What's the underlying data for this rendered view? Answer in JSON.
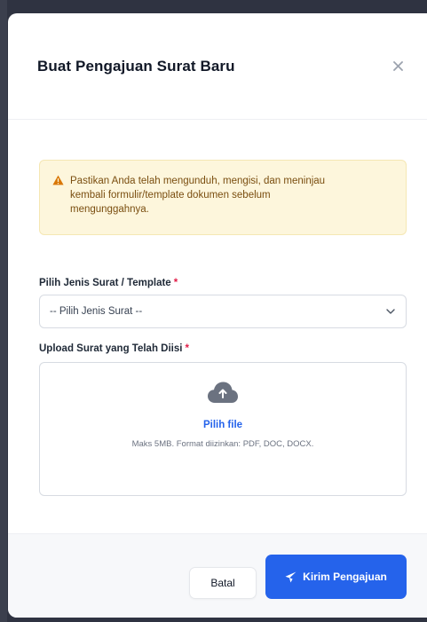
{
  "modal": {
    "title": "Buat Pengajuan Surat Baru",
    "close_icon": "close-icon"
  },
  "alert": {
    "icon": "warning-icon",
    "line1": "Pastikan Anda telah mengunduh, mengisi, dan meninjau",
    "line2": "kembali formulir/template dokumen sebelum",
    "line3": "mengunggahnya."
  },
  "form": {
    "template_label": "Pilih Jenis Surat / Template",
    "required_mark": "*",
    "template_select_value": "-- Pilih Jenis Surat --",
    "upload_label": "Upload Surat yang Telah Diisi",
    "upload_icon": "cloud-upload-icon",
    "choose_file": "Pilih file",
    "file_help": "Maks 5MB. Format diizinkan: PDF, DOC, DOCX."
  },
  "footer": {
    "cancel_label": "Batal",
    "submit_label": "Kirim Pengajuan",
    "submit_icon": "send-icon"
  },
  "colors": {
    "primary": "#2563eb",
    "alert_bg": "#fdf6dc",
    "warning": "#d97706",
    "required": "#e11d48"
  }
}
